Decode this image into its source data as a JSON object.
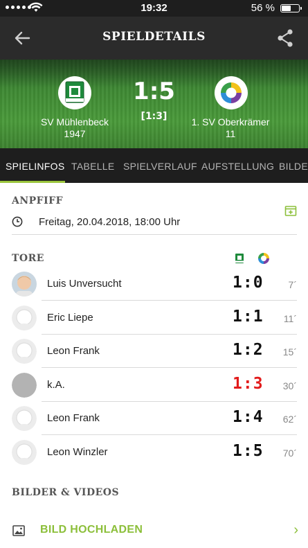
{
  "status_bar": {
    "time": "19:32",
    "battery_percent": "56 %",
    "battery_level": 0.56
  },
  "app_bar": {
    "title": "SPIELDETAILS",
    "back_icon": "arrow-left-icon",
    "share_icon": "share-icon"
  },
  "match": {
    "home_team": "SV Mühlenbeck",
    "home_team_line2": "1947",
    "away_team": "1. SV Oberkrämer",
    "away_team_line2": "11",
    "score": "1:5",
    "halftime": "[1:3]"
  },
  "tabs": [
    {
      "label": "SPIELINFOS",
      "active": true
    },
    {
      "label": "TABELLE",
      "active": false
    },
    {
      "label": "SPIELVERLAUF",
      "active": false
    },
    {
      "label": "AUFSTELLUNG",
      "active": false
    },
    {
      "label": "BILDER",
      "active": false
    }
  ],
  "kickoff": {
    "heading": "ANPFIFF",
    "datetime": "Freitag, 20.04.2018, 18:00 Uhr"
  },
  "goals": {
    "heading": "TORE",
    "items": [
      {
        "player": "Luis Unversucht",
        "score": "1:0",
        "minute": "7´",
        "highlight": false,
        "avatar": "photo"
      },
      {
        "player": "Eric Liepe",
        "score": "1:1",
        "minute": "11´",
        "highlight": false,
        "avatar": "placeholder"
      },
      {
        "player": "Leon Frank",
        "score": "1:2",
        "minute": "15´",
        "highlight": false,
        "avatar": "placeholder"
      },
      {
        "player": "k.A.",
        "score": "1:3",
        "minute": "30´",
        "highlight": true,
        "avatar": "grey"
      },
      {
        "player": "Leon Frank",
        "score": "1:4",
        "minute": "62´",
        "highlight": false,
        "avatar": "placeholder"
      },
      {
        "player": "Leon Winzler",
        "score": "1:5",
        "minute": "70´",
        "highlight": false,
        "avatar": "placeholder"
      }
    ]
  },
  "media": {
    "heading": "BILDER & VIDEOS",
    "upload_label": "BILD HOCHLADEN",
    "chevron": "›"
  },
  "colors": {
    "accent": "#8cbf3a",
    "appbar": "#2b2b2b",
    "tabbar": "#1e1e1e",
    "highlight_score": "#e21b1b"
  }
}
